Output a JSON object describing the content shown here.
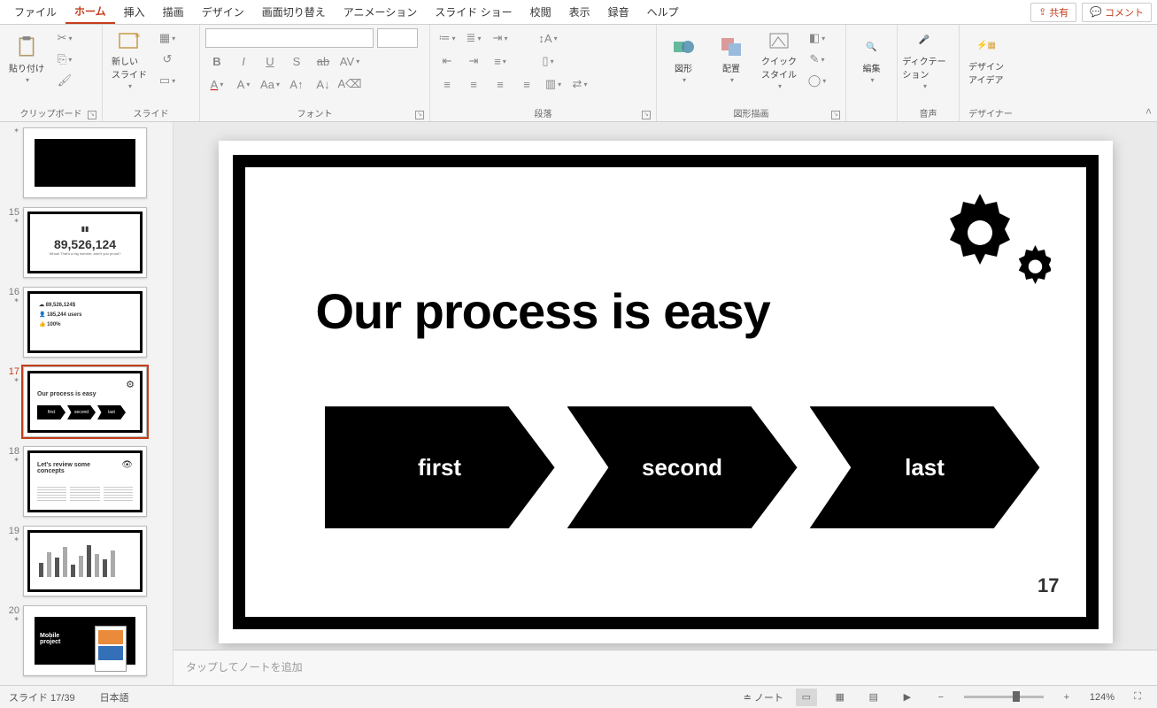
{
  "menu": {
    "file": "ファイル",
    "home": "ホーム",
    "insert": "挿入",
    "draw": "描画",
    "design": "デザイン",
    "transitions": "画面切り替え",
    "animations": "アニメーション",
    "slideshow": "スライド ショー",
    "review": "校閲",
    "view": "表示",
    "record": "録音",
    "help": "ヘルプ",
    "share": "共有",
    "comments": "コメント"
  },
  "ribbon": {
    "clipboard": {
      "label": "クリップボード",
      "paste": "貼り付け"
    },
    "slides": {
      "label": "スライド",
      "new": "新しい\nスライド"
    },
    "font": {
      "label": "フォント"
    },
    "paragraph": {
      "label": "段落"
    },
    "drawing": {
      "label": "図形描画",
      "shapes": "図形",
      "arrange": "配置",
      "quick": "クイック\nスタイル"
    },
    "editing": {
      "label": "編集"
    },
    "voice": {
      "label": "音声",
      "dictate": "ディクテー\nション"
    },
    "designer": {
      "label": "デザイナー",
      "ideas": "デザイン\nアイデア"
    }
  },
  "thumbs": [
    {
      "n": "",
      "type": "map"
    },
    {
      "n": "15",
      "type": "bignum",
      "v": "89,526,124",
      "sub": "Whoa! That's a big number, aren't you proud?"
    },
    {
      "n": "16",
      "type": "stats",
      "a": "89,526,124$",
      "b": "185,244 users",
      "c": "100%"
    },
    {
      "n": "17",
      "type": "process",
      "title": "Our process is easy",
      "steps": [
        "first",
        "second",
        "last"
      ]
    },
    {
      "n": "18",
      "type": "review",
      "title": "Let's review some\nconcepts"
    },
    {
      "n": "19",
      "type": "bars"
    },
    {
      "n": "20",
      "type": "mobile",
      "title": "Mobile\nproject"
    }
  ],
  "slide": {
    "title": "Our process is easy",
    "steps": [
      "first",
      "second",
      "last"
    ],
    "number": "17"
  },
  "notes": {
    "placeholder": "タップしてノートを追加"
  },
  "status": {
    "slide": "スライド 17/39",
    "lang": "日本語",
    "notes": "ノート",
    "zoom": "124%"
  }
}
